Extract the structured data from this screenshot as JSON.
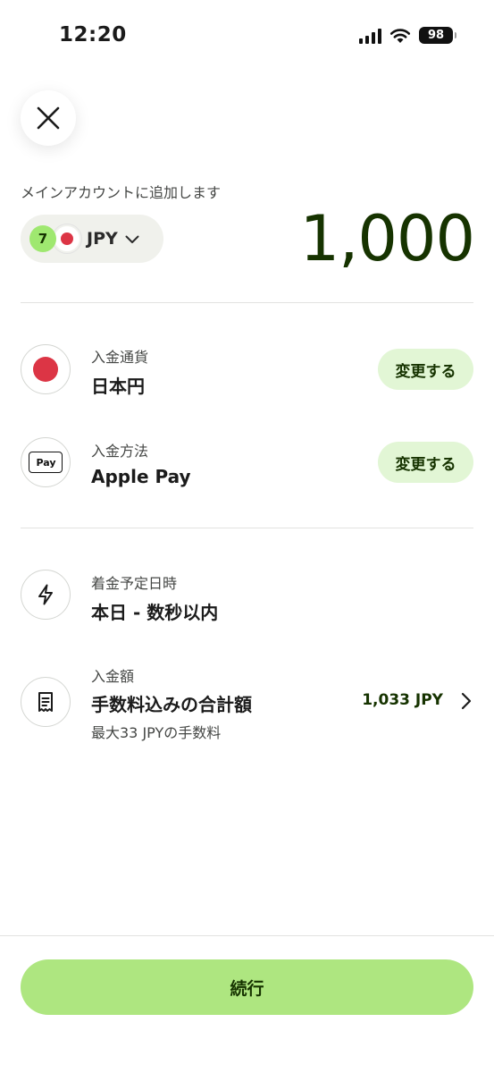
{
  "status_bar": {
    "time": "12:20",
    "battery": "98"
  },
  "header": {
    "add_label": "メインアカウントに追加します",
    "currency_code": "JPY",
    "amount": "1,000"
  },
  "rows": {
    "currency": {
      "label": "入金通貨",
      "value": "日本円",
      "button": "変更する"
    },
    "method": {
      "label": "入金方法",
      "value": "Apple Pay",
      "button": "変更する",
      "icon_text": "Pay"
    },
    "arrival": {
      "label": "着金予定日時",
      "value": "本日 - 数秒以内"
    },
    "total": {
      "label": "入金額",
      "value": "手数料込みの合計額",
      "sub": "最大33 JPYの手数料",
      "amount": "1,033 JPY"
    }
  },
  "footer": {
    "continue_label": "続行"
  },
  "colors": {
    "accent": "#9fe870",
    "button_bg": "#aee680",
    "dark_green": "#163300",
    "flag_red": "#dc3545"
  }
}
